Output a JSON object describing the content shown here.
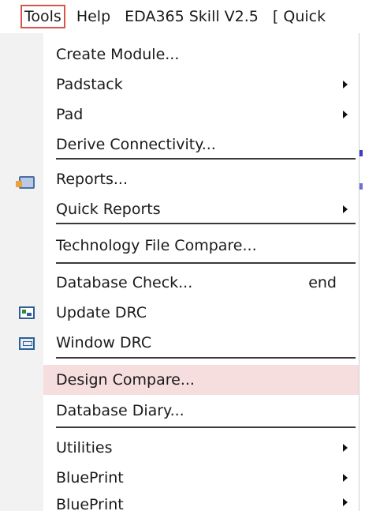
{
  "menubar": {
    "items": [
      {
        "label": "Tools",
        "active": true
      },
      {
        "label": "Help",
        "active": false
      },
      {
        "label": "EDA365 Skill V2.5",
        "active": false
      },
      {
        "label": "[ Quick",
        "active": false
      }
    ]
  },
  "menu": {
    "items": [
      {
        "label": "Create Module...",
        "submenu": false
      },
      {
        "label": "Padstack",
        "submenu": true
      },
      {
        "label": "Pad",
        "submenu": true
      },
      {
        "label": "Derive Connectivity...",
        "submenu": false
      },
      {
        "label": "Reports...",
        "submenu": false,
        "icon": "reports-icon"
      },
      {
        "label": "Quick Reports",
        "submenu": true
      },
      {
        "label": "Technology File Compare...",
        "submenu": false
      },
      {
        "label": "Database Check...",
        "submenu": false,
        "shortcut": "end"
      },
      {
        "label": "Update DRC",
        "submenu": false,
        "icon": "update-drc-icon"
      },
      {
        "label": "Window DRC",
        "submenu": false,
        "icon": "window-drc-icon"
      },
      {
        "label": "Design Compare...",
        "submenu": false,
        "highlighted": true
      },
      {
        "label": "Database Diary...",
        "submenu": false
      },
      {
        "label": "Utilities",
        "submenu": true
      },
      {
        "label": "BluePrint",
        "submenu": true
      },
      {
        "label": "BluePrint",
        "submenu": true
      }
    ]
  },
  "colors": {
    "highlight": "#f6dede",
    "active_border": "#d9534f",
    "separator": "#3a3a3a"
  }
}
